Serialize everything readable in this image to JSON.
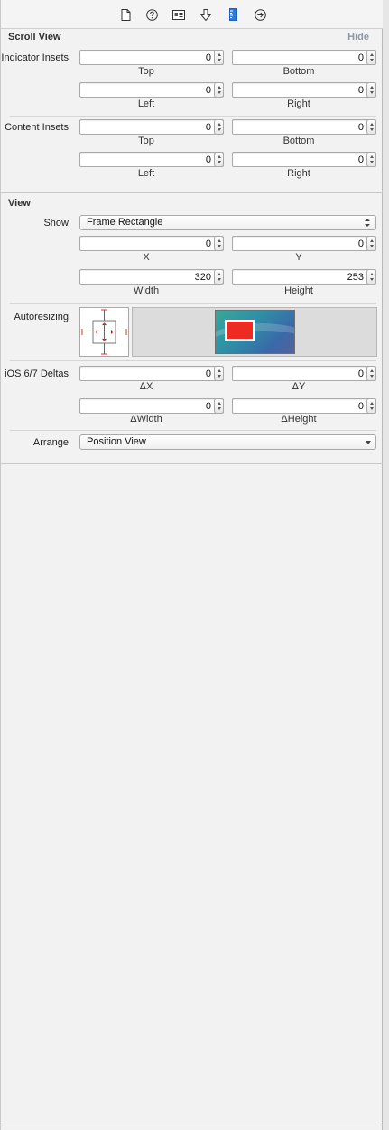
{
  "toolbar": {
    "icons": [
      "file-inspector-icon",
      "quick-help-icon",
      "identity-inspector-icon",
      "attributes-inspector-icon",
      "size-inspector-icon",
      "connections-inspector-icon"
    ]
  },
  "scroll_view": {
    "title": "Scroll View",
    "hide_label": "Hide",
    "indicator_insets": {
      "label": "Indicator Insets",
      "top": "0",
      "bottom": "0",
      "left": "0",
      "right": "0",
      "top_label": "Top",
      "bottom_label": "Bottom",
      "left_label": "Left",
      "right_label": "Right"
    },
    "content_insets": {
      "label": "Content Insets",
      "top": "0",
      "bottom": "0",
      "left": "0",
      "right": "0",
      "top_label": "Top",
      "bottom_label": "Bottom",
      "left_label": "Left",
      "right_label": "Right"
    }
  },
  "view": {
    "title": "View",
    "show_label": "Show",
    "show_value": "Frame Rectangle",
    "x": "0",
    "y": "0",
    "width": "320",
    "height": "253",
    "x_label": "X",
    "y_label": "Y",
    "width_label": "Width",
    "height_label": "Height",
    "autoresizing_label": "Autoresizing",
    "ios_deltas_label": "iOS 6/7 Deltas",
    "dx": "0",
    "dy": "0",
    "dwidth": "0",
    "dheight": "0",
    "dx_label": "ΔX",
    "dy_label": "ΔY",
    "dwidth_label": "ΔWidth",
    "dheight_label": "ΔHeight",
    "arrange_label": "Arrange",
    "arrange_value": "Position View"
  },
  "colors": {
    "selected_tab": "#2f7bdc",
    "spring_red": "#d23a2e",
    "preview_rect": "#ee2b22"
  }
}
